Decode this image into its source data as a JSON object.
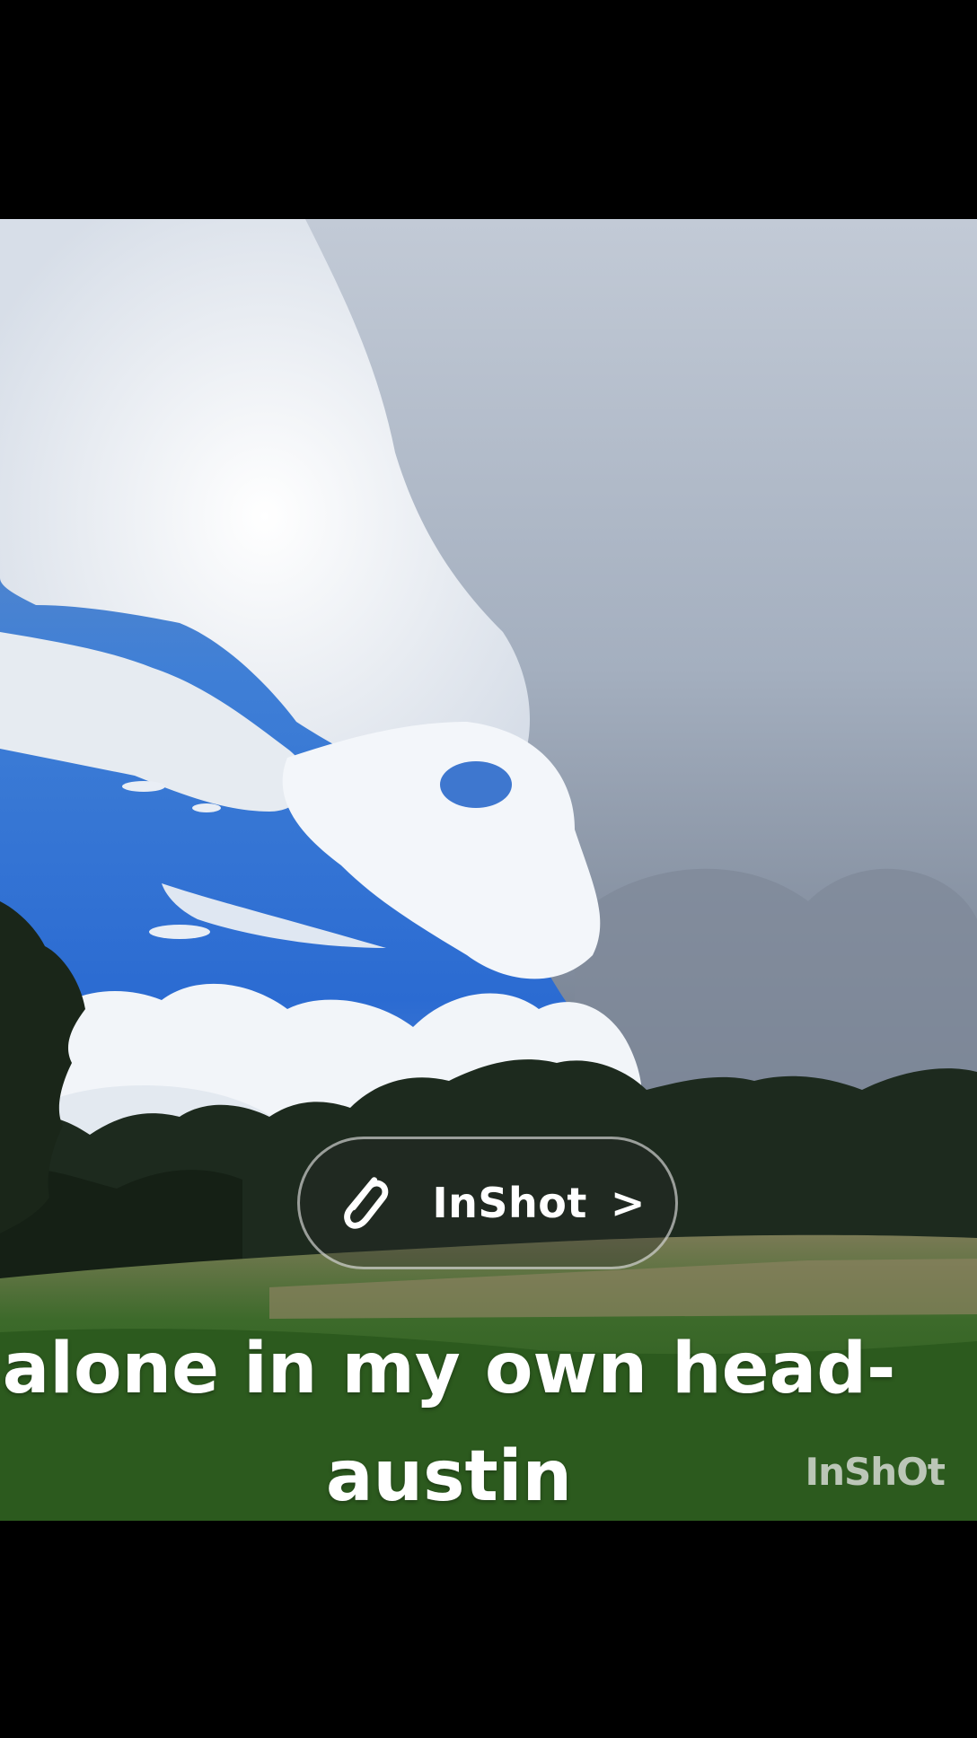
{
  "overlay": {
    "button_label": "InShot",
    "button_chevron": ">"
  },
  "caption": {
    "line1": "alone in my own head-",
    "line2": "austin"
  },
  "watermark": {
    "text": "InShOt"
  },
  "icons": {
    "clip": "paperclip-icon"
  }
}
